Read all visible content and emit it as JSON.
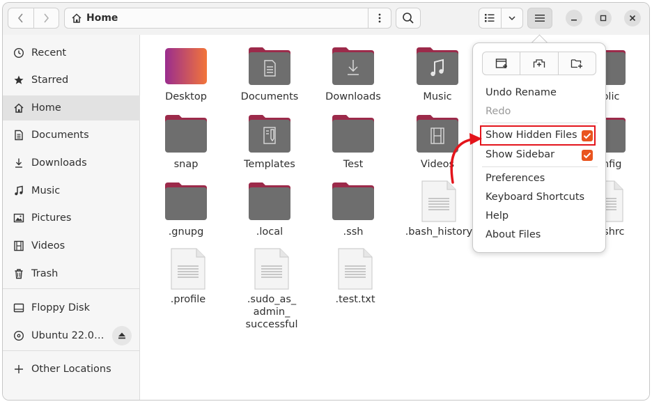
{
  "header": {
    "path_label": "Home"
  },
  "sidebar": {
    "items": [
      {
        "label": "Recent",
        "icon": "clock-icon"
      },
      {
        "label": "Starred",
        "icon": "star-icon"
      },
      {
        "label": "Home",
        "icon": "home-icon",
        "active": true
      },
      {
        "label": "Documents",
        "icon": "document-icon"
      },
      {
        "label": "Downloads",
        "icon": "download-icon"
      },
      {
        "label": "Music",
        "icon": "music-icon"
      },
      {
        "label": "Pictures",
        "icon": "picture-icon"
      },
      {
        "label": "Videos",
        "icon": "film-icon"
      },
      {
        "label": "Trash",
        "icon": "trash-icon"
      }
    ],
    "devices": [
      {
        "label": "Floppy Disk",
        "icon": "drive-icon"
      },
      {
        "label": "Ubuntu 22.0…",
        "icon": "disc-icon"
      }
    ],
    "other_locations": "Other Locations"
  },
  "files": [
    {
      "name": "Desktop",
      "kind": "desktop"
    },
    {
      "name": "Documents",
      "kind": "folder-documents"
    },
    {
      "name": "Downloads",
      "kind": "folder-downloads"
    },
    {
      "name": "Music",
      "kind": "folder-music"
    },
    {
      "name": "Public",
      "kind": "folder-public"
    },
    {
      "name": "snap",
      "kind": "folder"
    },
    {
      "name": "Templates",
      "kind": "folder-templates"
    },
    {
      "name": "Test",
      "kind": "folder"
    },
    {
      "name": "Videos",
      "kind": "folder-videos"
    },
    {
      "name": ".config",
      "kind": "folder"
    },
    {
      "name": ".gnupg",
      "kind": "folder"
    },
    {
      "name": ".local",
      "kind": "folder"
    },
    {
      "name": ".ssh",
      "kind": "folder"
    },
    {
      "name": ".bash_history",
      "kind": "text"
    },
    {
      "name": ".bashrc",
      "kind": "text"
    },
    {
      "name": ".profile",
      "kind": "text"
    },
    {
      "name": ".sudo_as_admin_successful",
      "display": ".sudo_as_\nadmin_\nsuccessful",
      "kind": "text"
    },
    {
      "name": ".test.txt",
      "kind": "text"
    }
  ],
  "menu": {
    "undo_rename": "Undo Rename",
    "redo": "Redo",
    "show_hidden_files": "Show Hidden Files",
    "show_sidebar": "Show Sidebar",
    "preferences": "Preferences",
    "keyboard_shortcuts": "Keyboard Shortcuts",
    "help": "Help",
    "about_files": "About Files",
    "show_hidden_checked": true,
    "show_sidebar_checked": true
  },
  "colors": {
    "accent": "#e9541f",
    "highlight": "#e3141b",
    "folder_body": "#6e6e6e",
    "folder_tab": "#9c2a4a"
  }
}
